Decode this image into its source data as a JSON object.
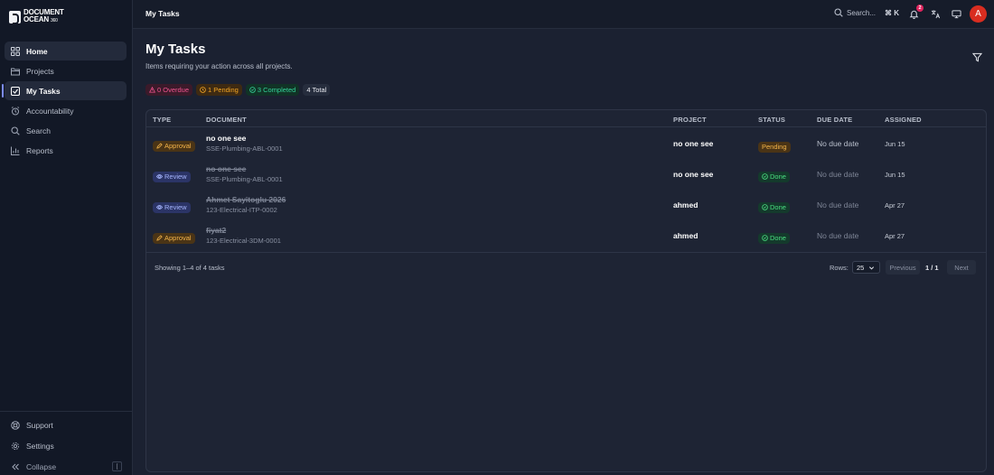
{
  "brand": {
    "line1": "DOCUMENT",
    "line2": "OCEAN",
    "line2_small": "360"
  },
  "sidebar": {
    "items": [
      {
        "label": "Home",
        "icon": "grid-icon"
      },
      {
        "label": "Projects",
        "icon": "folder-icon"
      },
      {
        "label": "My Tasks",
        "icon": "checkbox-icon"
      },
      {
        "label": "Accountability",
        "icon": "alarm-icon"
      },
      {
        "label": "Search",
        "icon": "search-icon"
      },
      {
        "label": "Reports",
        "icon": "bar-chart-icon"
      }
    ],
    "bottom": [
      {
        "label": "Support",
        "icon": "lifebuoy-icon"
      },
      {
        "label": "Settings",
        "icon": "gear-icon"
      }
    ],
    "collapse_label": "Collapse",
    "collapse_key": "["
  },
  "topbar": {
    "breadcrumb": "My Tasks",
    "search_label": "Search...",
    "search_shortcut": "⌘ K",
    "notification_count": "2",
    "avatar_initial": "A"
  },
  "page": {
    "title": "My Tasks",
    "subtitle": "Items requiring your action across all projects."
  },
  "summary": {
    "overdue": "0 Overdue",
    "pending": "1 Pending",
    "completed": "3 Completed",
    "total": "4 Total"
  },
  "table": {
    "columns": [
      "TYPE",
      "DOCUMENT",
      "PROJECT",
      "STATUS",
      "DUE DATE",
      "ASSIGNED"
    ],
    "rows": [
      {
        "type": "Approval",
        "title": "no one see",
        "code": "SSE-Plumbing-ABL-0001",
        "project": "no one see",
        "status": "Pending",
        "due": "No due date",
        "assigned": "Jun 15"
      },
      {
        "type": "Review",
        "title": "no one see",
        "code": "SSE-Plumbing-ABL-0001",
        "project": "no one see",
        "status": "Done",
        "due": "No due date",
        "assigned": "Jun 15"
      },
      {
        "type": "Review",
        "title": "Ahmet Sayitoglu 2026",
        "code": "123-Electrical-ITP-0002",
        "project": "ahmed",
        "status": "Done",
        "due": "No due date",
        "assigned": "Apr 27"
      },
      {
        "type": "Approval",
        "title": "fiyat2",
        "code": "123-Electrical-3DM-0001",
        "project": "ahmed",
        "status": "Done",
        "due": "No due date",
        "assigned": "Apr 27"
      }
    ]
  },
  "footer": {
    "showing": "Showing 1–4 of 4 tasks",
    "rows_label": "Rows:",
    "rows_value": "25",
    "previous": "Previous",
    "page_indicator": "1 / 1",
    "next": "Next"
  },
  "colors": {
    "accent": "#7c8cf8",
    "pending": "#f5a623",
    "done": "#4ade80",
    "overdue": "#f0548f",
    "avatar": "#d92d20"
  }
}
